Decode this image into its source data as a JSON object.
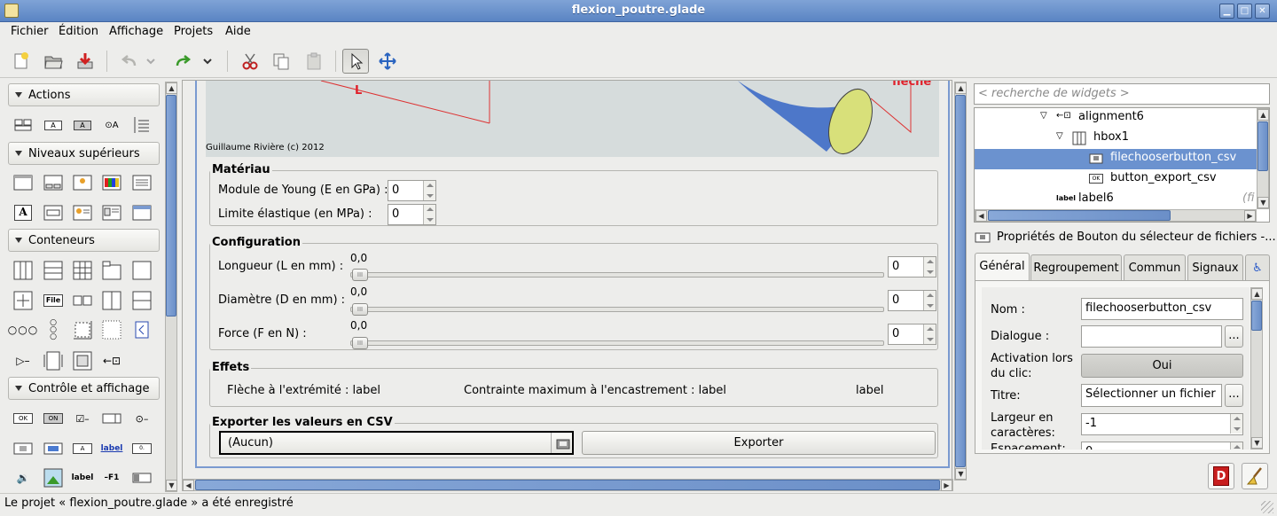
{
  "window": {
    "title": "flexion_poutre.glade"
  },
  "menu": {
    "items": [
      "Fichier",
      "Édition",
      "Affichage",
      "Projets",
      "Aide"
    ]
  },
  "palette": {
    "sections": [
      "Actions",
      "Niveaux supérieurs",
      "Conteneurs",
      "Contrôle et affichage"
    ],
    "icon_texts": {
      "label_a": "A",
      "file": "File",
      "ok": "OK",
      "on": "ON",
      "label": "label",
      "f1": "F1",
      "zero": "0."
    }
  },
  "design": {
    "image_caption": "Guillaume Rivière (c) 2012",
    "image_label_l": "L",
    "image_label_fleche": "flèche",
    "materiau": {
      "title": "Matériau",
      "young_label": "Module de Young (E en GPa) :",
      "young_value": "0",
      "limite_label": "Limite élastique (en MPa) :",
      "limite_value": "0"
    },
    "configuration": {
      "title": "Configuration",
      "rows": [
        {
          "label": "Longueur (L en mm) :",
          "slider_value": "0,0",
          "spin_value": "0"
        },
        {
          "label": "Diamètre (D en mm) :",
          "slider_value": "0,0",
          "spin_value": "0"
        },
        {
          "label": "Force (F en N) :",
          "slider_value": "0,0",
          "spin_value": "0"
        }
      ]
    },
    "effets": {
      "title": "Effets",
      "fleche": "Flèche à l'extrémité : label",
      "contrainte": "Contrainte maximum à l'encastrement : label",
      "label3": "label"
    },
    "export": {
      "title": "Exporter les valeurs en CSV",
      "file_value": "(Aucun)",
      "button": "Exporter"
    }
  },
  "inspector": {
    "search_placeholder": "< recherche de widgets >",
    "tree": [
      {
        "name": "alignment6",
        "indent": 5
      },
      {
        "name": "hbox1",
        "indent": 6
      },
      {
        "name": "filechooserbutton_csv",
        "indent": 8,
        "selected": true
      },
      {
        "name": "button_export_csv",
        "indent": 8
      },
      {
        "name": "label6",
        "indent": 4,
        "extra": "(fi"
      }
    ]
  },
  "properties": {
    "header": "Propriétés de Bouton du sélecteur de fichiers -...",
    "tabs": [
      "Général",
      "Regroupement",
      "Commun",
      "Signaux"
    ],
    "active_tab": "Général",
    "fields": {
      "nom_label": "Nom :",
      "nom_value": "filechooserbutton_csv",
      "dialogue_label": "Dialogue :",
      "dialogue_value": "",
      "ellipsis": "...",
      "activation_label_1": "Activation lors",
      "activation_label_2": "du clic:",
      "activation_value": "Oui",
      "titre_label": "Titre:",
      "titre_value": "Sélectionner un fichier",
      "largeur_label_1": "Largeur en",
      "largeur_label_2": "caractères:",
      "largeur_value": "-1",
      "espacement_label": "Espacement:",
      "espacement_value": "0"
    }
  },
  "statusbar": {
    "text": "Le projet « flexion_poutre.glade » a été enregistré"
  },
  "colors": {
    "titlebar": "#6a90cb",
    "selection": "#6b92cf",
    "accent_red": "#e0202a"
  }
}
